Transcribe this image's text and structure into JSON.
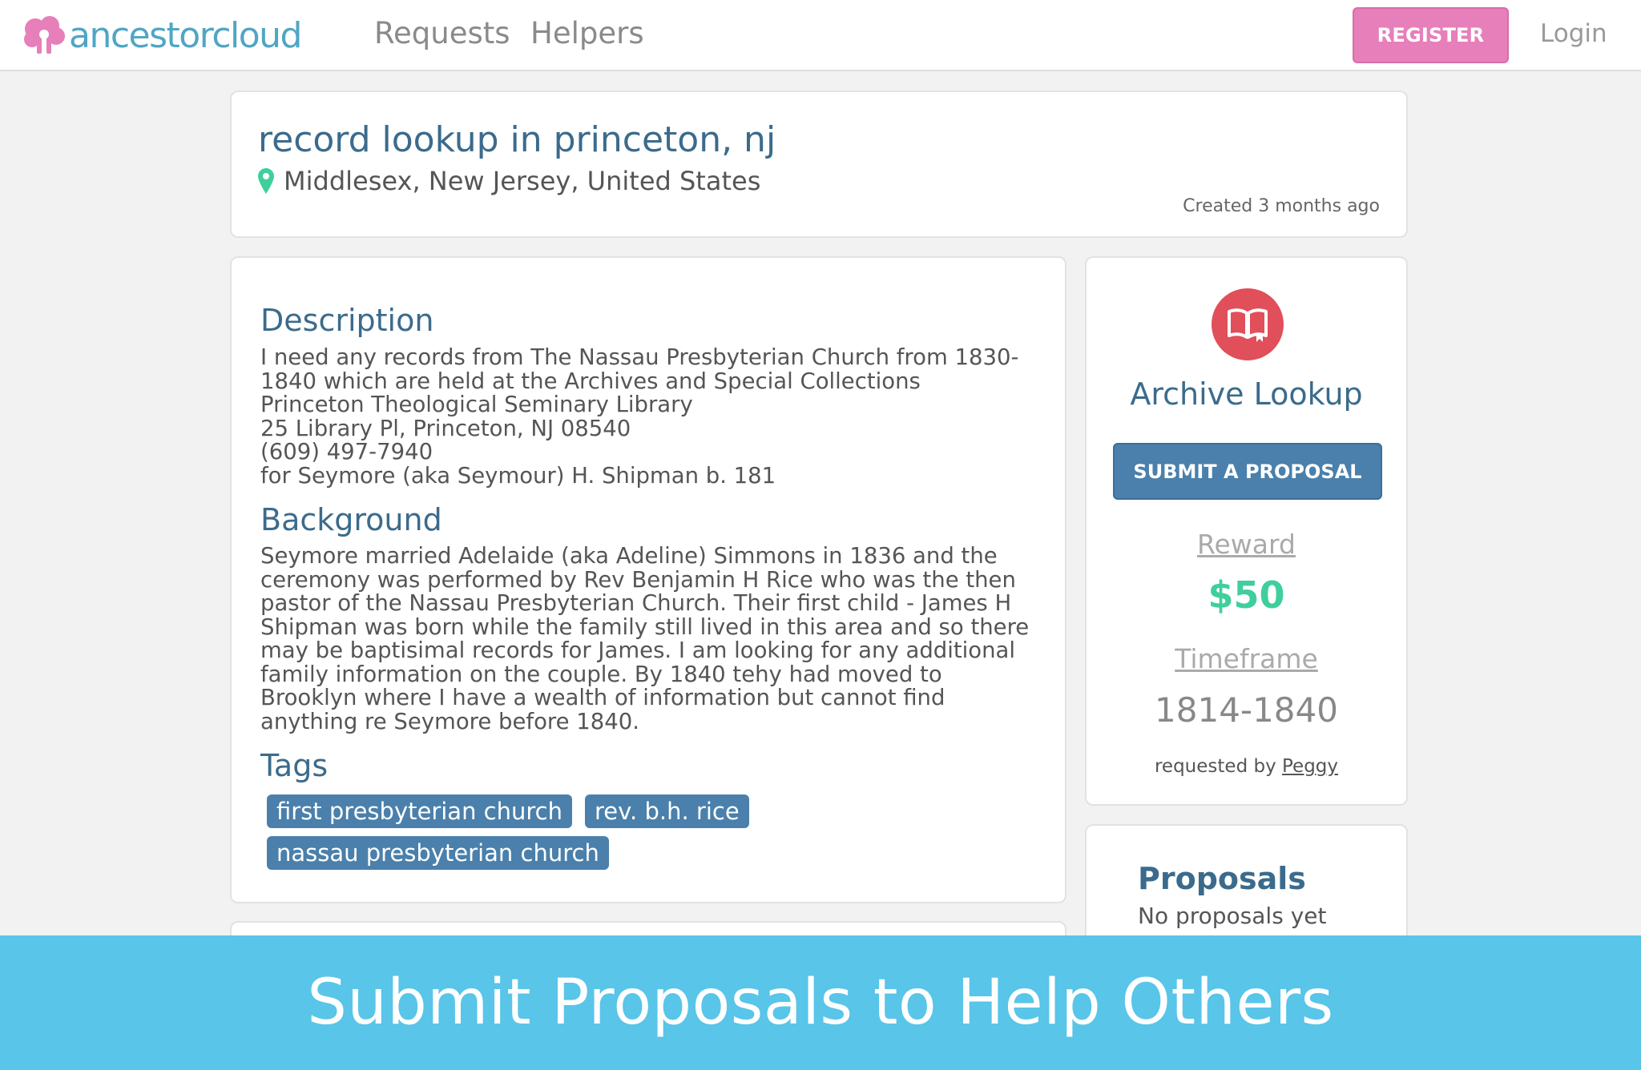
{
  "nav": {
    "logo_text": "ancestorcloud",
    "links": [
      "Requests",
      "Helpers"
    ],
    "register_label": "REGISTER",
    "login_label": "Login"
  },
  "request": {
    "title": "record lookup in princeton, nj",
    "location": "Middlesex, New Jersey, United States",
    "created": "Created 3 months ago"
  },
  "details": {
    "description_heading": "Description",
    "description": "I need any records from The Nassau Presbyterian Church from 1830-\n1840 which are held at the Archives and Special Collections\nPrinceton Theological Seminary Library\n25 Library Pl, Princeton, NJ 08540\n(609) 497-7940\nfor Seymore (aka Seymour) H. Shipman b. 181",
    "background_heading": "Background",
    "background": "Seymore married Adelaide (aka Adeline) Simmons in 1836 and the\nceremony was performed by Rev Benjamin H Rice who was the then\npastor of the Nassau Presbyterian Church. Their first child - James H\nShipman was born while the family still lived in this area and so there\nmay be baptisimal records for James. I am looking for any additional\nfamily information on the couple. By 1840 tehy had moved to\nBrooklyn where I have a wealth of information but cannot find\nanything re Seymore before 1840.",
    "tags_heading": "Tags",
    "tags": [
      "first presbyterian church",
      "rev. b.h. rice",
      "nassau presbyterian church"
    ]
  },
  "sidebar": {
    "type_icon": "book-icon",
    "type_title": "Archive Lookup",
    "submit_label": "SUBMIT A PROPOSAL",
    "reward_label": "Reward",
    "reward_value": "$50",
    "timeframe_label": "Timeframe",
    "timeframe_value": "1814-1840",
    "requested_by_prefix": "requested by",
    "requested_by_name": "Peggy"
  },
  "proposals": {
    "heading": "Proposals",
    "empty_text": "No proposals yet"
  },
  "banner": {
    "text": "Submit Proposals to Help Others"
  },
  "colors": {
    "brand_blue": "#4fa6c4",
    "brand_pink": "#e67fba",
    "heading_blue": "#3b6b8c",
    "button_blue": "#4a80ab",
    "reward_green": "#3fcf9d",
    "banner_blue": "#58c5e9",
    "icon_red": "#e04f5a"
  }
}
